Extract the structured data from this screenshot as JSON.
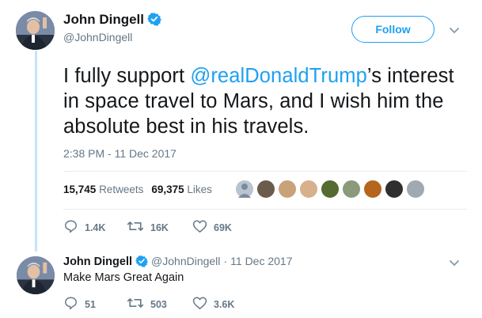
{
  "tweet": {
    "author_name": "John Dingell",
    "author_handle": "@JohnDingell",
    "follow_label": "Follow",
    "text_before": "I fully support ",
    "mention": "@realDonaldTrump",
    "text_after": "’s interest in space travel to Mars, and I wish him the absolute best in his travels.",
    "timestamp": "2:38 PM - 11 Dec 2017",
    "retweets_count": "15,745",
    "retweets_label": "Retweets",
    "likes_count": "69,375",
    "likes_label": "Likes",
    "actions": {
      "reply_count": "1.4K",
      "retweet_count": "16K",
      "like_count": "69K"
    }
  },
  "reply": {
    "author_name": "John Dingell",
    "author_handle": "@JohnDingell",
    "separator": "·",
    "date": "11 Dec 2017",
    "text": "Make Mars Great Again",
    "actions": {
      "reply_count": "51",
      "retweet_count": "503",
      "like_count": "3.6K"
    }
  },
  "colors": {
    "accent": "#1da1f2",
    "muted": "#657786",
    "thread_line": "#c4e3f7"
  },
  "icons": [
    "verified-badge-icon",
    "chevron-down-icon",
    "reply-icon",
    "retweet-icon",
    "heart-icon"
  ]
}
